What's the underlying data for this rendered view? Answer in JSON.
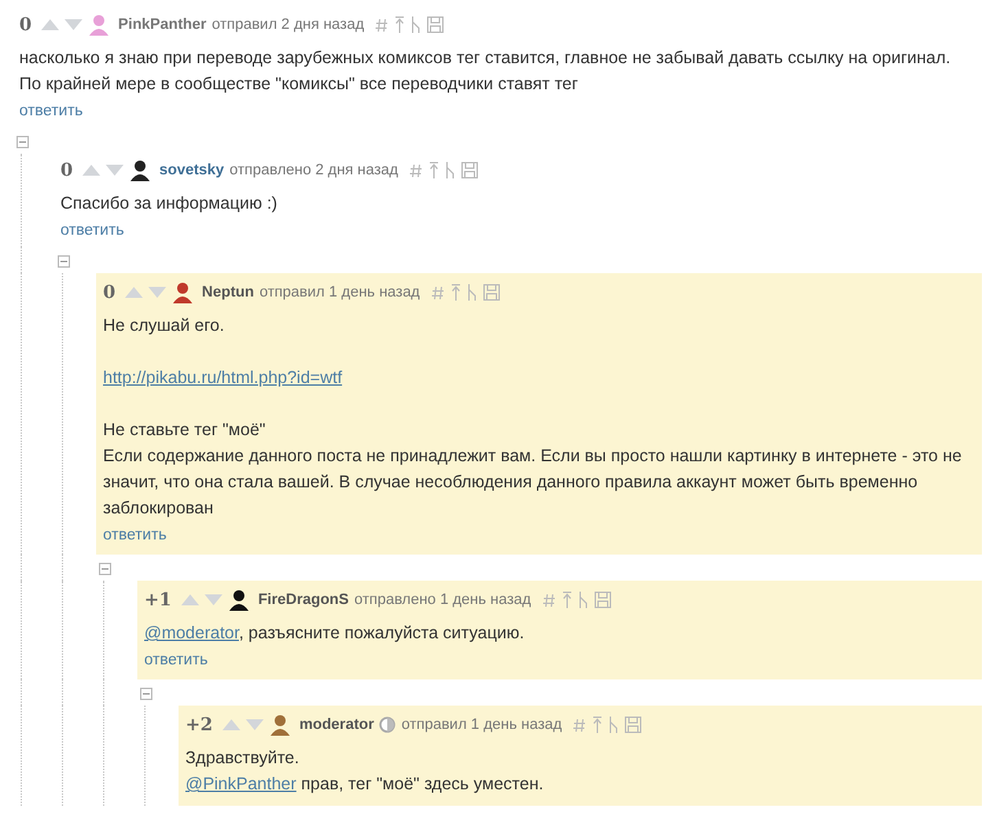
{
  "comments": [
    {
      "rating": "0",
      "avatar": {
        "color": "#e8a0d8"
      },
      "author": {
        "name": "PinkPanther",
        "color": "#777777"
      },
      "time": "отправил 2 дня назад",
      "highlighted": false,
      "moderator_badge": false,
      "expanded": true,
      "body": [
        [
          [
            {
              "kind": "text",
              "text": "насколько я знаю при переводе зарубежных комиксов тег ставится, главное не забывай давать ссылку на оригинал."
            }
          ],
          [
            {
              "kind": "text",
              "text": "По крайней мере в сообществе \"комиксы\" все переводчики ставят тег"
            }
          ]
        ]
      ],
      "reply": "ответить",
      "children": [
        {
          "rating": "0",
          "avatar": {
            "color": "#222222"
          },
          "author": {
            "name": "sovetsky",
            "color": "#3f6f96"
          },
          "time": "отправлено 2 дня назад",
          "highlighted": false,
          "moderator_badge": false,
          "expanded": true,
          "body": [
            [
              [
                {
                  "kind": "text",
                  "text": "Спасибо за информацию :)"
                }
              ]
            ]
          ],
          "reply": "ответить",
          "children": [
            {
              "rating": "0",
              "avatar": {
                "color": "#c0392b"
              },
              "author": {
                "name": "Neptun",
                "color": "#555555"
              },
              "time": "отправил 1 день назад",
              "highlighted": true,
              "moderator_badge": false,
              "expanded": true,
              "body": [
                [
                  [
                    {
                      "kind": "text",
                      "text": "Не слушай его."
                    }
                  ]
                ],
                [
                  [
                    {
                      "kind": "link",
                      "text": "http://pikabu.ru/html.php?id=wtf"
                    }
                  ]
                ],
                [
                  [
                    {
                      "kind": "text",
                      "text": "Не ставьте тег \"моё\""
                    }
                  ],
                  [
                    {
                      "kind": "text",
                      "text": "Если содержание данного поста не принадлежит вам. Если вы просто нашли картинку в интернете - это не значит, что она стала вашей. В случае несоблюдения данного правила аккаунт может быть временно заблокирован"
                    }
                  ]
                ]
              ],
              "reply": "ответить",
              "children": [
                {
                  "rating": "+1",
                  "avatar": {
                    "color": "#111111"
                  },
                  "author": {
                    "name": "FireDragonS",
                    "color": "#555555"
                  },
                  "time": "отправлено 1 день назад",
                  "highlighted": true,
                  "moderator_badge": false,
                  "expanded": true,
                  "body": [
                    [
                      [
                        {
                          "kind": "link",
                          "text": "@moderator"
                        },
                        {
                          "kind": "text",
                          "text": ", разъясните пожалуйста ситуацию."
                        }
                      ]
                    ]
                  ],
                  "reply": "ответить",
                  "children": [
                    {
                      "rating": "+2",
                      "avatar": {
                        "color": "#a0703a"
                      },
                      "author": {
                        "name": "moderator",
                        "color": "#555555"
                      },
                      "time": "отправил 1 день назад",
                      "highlighted": true,
                      "moderator_badge": true,
                      "body": [
                        [
                          [
                            {
                              "kind": "text",
                              "text": "Здравствуйте."
                            }
                          ],
                          [
                            {
                              "kind": "link",
                              "text": "@PinkPanther"
                            },
                            {
                              "kind": "text",
                              "text": " прав, тег \"моё\" здесь уместен."
                            }
                          ]
                        ]
                      ]
                    }
                  ]
                }
              ]
            }
          ]
        }
      ]
    }
  ]
}
